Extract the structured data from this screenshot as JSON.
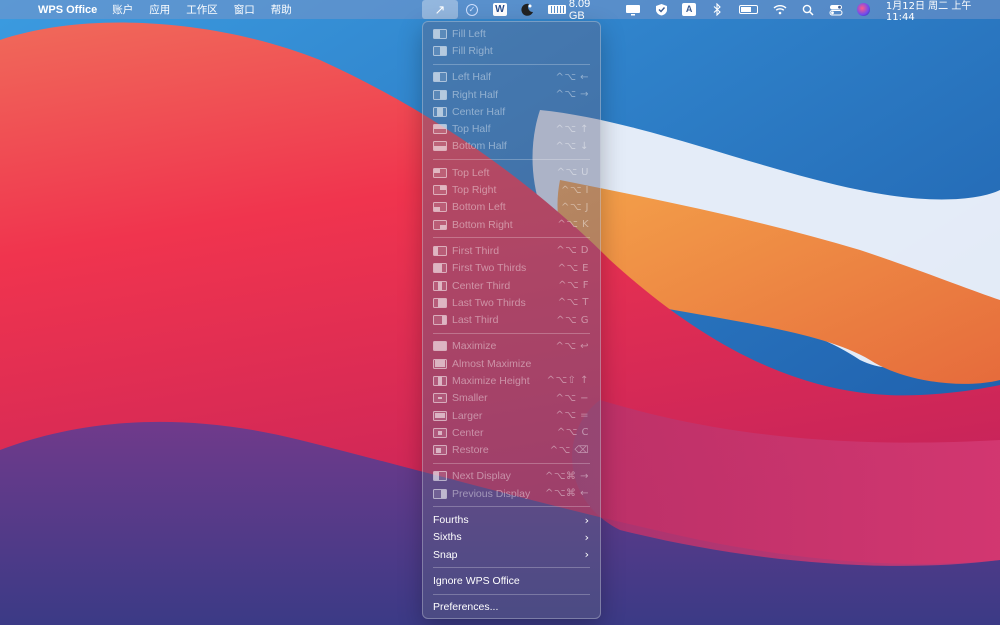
{
  "menubar": {
    "apple": "",
    "app_name": "WPS Office",
    "menus": [
      "账户",
      "应用",
      "工作区",
      "窗口",
      "帮助"
    ],
    "memory": "8.09 GB",
    "input_method": "A",
    "clock": "1月12日 周二 上午11:44"
  },
  "icons": {
    "rectangle_app": "↗",
    "check": "✓",
    "wps": "W",
    "chevron_right": "›",
    "chevron_down": "⌄"
  },
  "dropdown": {
    "groups": [
      [
        {
          "label": "Fill Left",
          "shortcut": ""
        },
        {
          "label": "Fill Right",
          "shortcut": ""
        }
      ],
      [
        {
          "label": "Left Half",
          "shortcut": "^⌥ ←"
        },
        {
          "label": "Right Half",
          "shortcut": "^⌥ →"
        },
        {
          "label": "Center Half",
          "shortcut": ""
        },
        {
          "label": "Top Half",
          "shortcut": "^⌥ ↑"
        },
        {
          "label": "Bottom Half",
          "shortcut": "^⌥ ↓"
        }
      ],
      [
        {
          "label": "Top Left",
          "shortcut": "^⌥ U"
        },
        {
          "label": "Top Right",
          "shortcut": "^⌥ I"
        },
        {
          "label": "Bottom Left",
          "shortcut": "^⌥ J"
        },
        {
          "label": "Bottom Right",
          "shortcut": "^⌥ K"
        }
      ],
      [
        {
          "label": "First Third",
          "shortcut": "^⌥ D"
        },
        {
          "label": "First Two Thirds",
          "shortcut": "^⌥ E"
        },
        {
          "label": "Center Third",
          "shortcut": "^⌥ F"
        },
        {
          "label": "Last Two Thirds",
          "shortcut": "^⌥ T"
        },
        {
          "label": "Last Third",
          "shortcut": "^⌥ G"
        }
      ],
      [
        {
          "label": "Maximize",
          "shortcut": "^⌥ ↩"
        },
        {
          "label": "Almost Maximize",
          "shortcut": ""
        },
        {
          "label": "Maximize Height",
          "shortcut": "^⌥⇧ ↑"
        },
        {
          "label": "Smaller",
          "shortcut": "^⌥ −"
        },
        {
          "label": "Larger",
          "shortcut": "^⌥ ="
        },
        {
          "label": "Center",
          "shortcut": "^⌥ C"
        },
        {
          "label": "Restore",
          "shortcut": "^⌥ ⌫"
        }
      ],
      [
        {
          "label": "Next Display",
          "shortcut": "^⌥⌘ →"
        },
        {
          "label": "Previous Display",
          "shortcut": "^⌥⌘ ←"
        }
      ]
    ],
    "submenus": [
      "Fourths",
      "Sixths",
      "Snap"
    ],
    "ignore_label": "Ignore WPS Office",
    "preferences_label": "Preferences..."
  }
}
